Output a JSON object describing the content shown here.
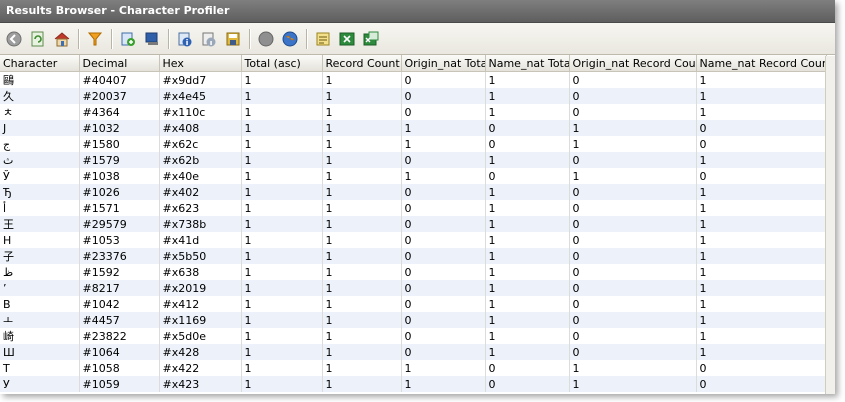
{
  "window": {
    "title": "Results Browser - Character Profiler"
  },
  "toolbar": {
    "icons": [
      "back-icon",
      "refresh-icon",
      "home-icon",
      "filter-icon",
      "add-database-icon",
      "export-icon",
      "info-icon",
      "info-settings-icon",
      "save-icon",
      "stop-icon",
      "globe-icon",
      "notes-icon",
      "excel-icon",
      "excel-export-icon"
    ]
  },
  "table": {
    "headers": [
      "Character",
      "Decimal",
      "Hex",
      "Total (asc)",
      "Record Count",
      "Origin_nat Total",
      "Name_nat Total",
      "Origin_nat Record Count",
      "Name_nat Record Count"
    ],
    "rows": [
      [
        "鷗",
        "#40407",
        "#x9dd7",
        "1",
        "1",
        "0",
        "1",
        "0",
        "1"
      ],
      [
        "久",
        "#20037",
        "#x4e45",
        "1",
        "1",
        "0",
        "1",
        "0",
        "1"
      ],
      [
        "ㅊ",
        "#4364",
        "#x110c",
        "1",
        "1",
        "0",
        "1",
        "0",
        "1"
      ],
      [
        "Ј",
        "#1032",
        "#x408",
        "1",
        "1",
        "1",
        "0",
        "1",
        "0"
      ],
      [
        "ج",
        "#1580",
        "#x62c",
        "1",
        "1",
        "1",
        "0",
        "1",
        "0"
      ],
      [
        "ث",
        "#1579",
        "#x62b",
        "1",
        "1",
        "0",
        "1",
        "0",
        "1"
      ],
      [
        "Ў",
        "#1038",
        "#x40e",
        "1",
        "1",
        "1",
        "0",
        "1",
        "0"
      ],
      [
        "Ђ",
        "#1026",
        "#x402",
        "1",
        "1",
        "0",
        "1",
        "0",
        "1"
      ],
      [
        "أ",
        "#1571",
        "#x623",
        "1",
        "1",
        "0",
        "1",
        "0",
        "1"
      ],
      [
        "王",
        "#29579",
        "#x738b",
        "1",
        "1",
        "0",
        "1",
        "0",
        "1"
      ],
      [
        "Н",
        "#1053",
        "#x41d",
        "1",
        "1",
        "0",
        "1",
        "0",
        "1"
      ],
      [
        "子",
        "#23376",
        "#x5b50",
        "1",
        "1",
        "0",
        "1",
        "0",
        "1"
      ],
      [
        "ظ",
        "#1592",
        "#x638",
        "1",
        "1",
        "0",
        "1",
        "0",
        "1"
      ],
      [
        "’",
        "#8217",
        "#x2019",
        "1",
        "1",
        "0",
        "1",
        "0",
        "1"
      ],
      [
        "В",
        "#1042",
        "#x412",
        "1",
        "1",
        "0",
        "1",
        "0",
        "1"
      ],
      [
        "ㅗ",
        "#4457",
        "#x1169",
        "1",
        "1",
        "0",
        "1",
        "0",
        "1"
      ],
      [
        "崎",
        "#23822",
        "#x5d0e",
        "1",
        "1",
        "0",
        "1",
        "0",
        "1"
      ],
      [
        "Ш",
        "#1064",
        "#x428",
        "1",
        "1",
        "0",
        "1",
        "0",
        "1"
      ],
      [
        "Т",
        "#1058",
        "#x422",
        "1",
        "1",
        "1",
        "0",
        "1",
        "0"
      ],
      [
        "У",
        "#1059",
        "#x423",
        "1",
        "1",
        "1",
        "0",
        "1",
        "0"
      ]
    ]
  }
}
